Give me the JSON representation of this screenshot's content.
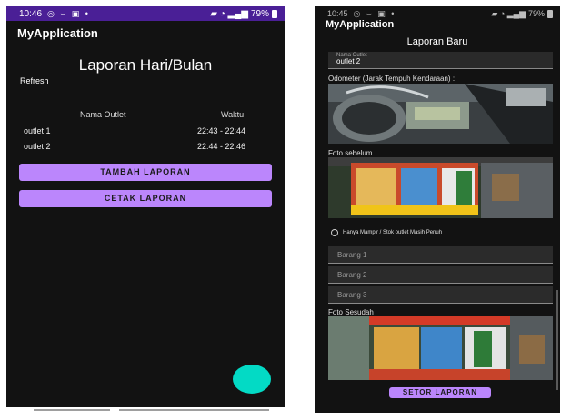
{
  "phone1": {
    "status_time": "10:46",
    "status_battery": "79%",
    "app_title": "MyApplication",
    "heading": "Laporan Hari/Bulan",
    "refresh": "Refresh",
    "columns": [
      "Nama Outlet",
      "Waktu"
    ],
    "rows": [
      {
        "outlet": "outlet 1",
        "time": "22:43 - 22:44"
      },
      {
        "outlet": "outlet 2",
        "time": "22:44 - 22:46"
      }
    ],
    "button_add": "TAMBAH LAPORAN",
    "button_print": "CETAK LAPORAN"
  },
  "phone2": {
    "status_time": "10:45",
    "status_battery": "79%",
    "app_title": "MyApplication",
    "heading": "Laporan Baru",
    "outlet_label": "Nama Outlet",
    "outlet_value": "outlet 2",
    "odometer_label": "Odometer (Jarak Tempuh Kendaraan) :",
    "before_label": "Foto sebelum",
    "radio_label": "Hanya Mampir / Stok outlet Masih Penuh",
    "items_placeholders": [
      "Barang 1",
      "Barang 2",
      "Barang 3"
    ],
    "after_label": "Foto Sesudah",
    "submit": "SETOR LAPORAN"
  },
  "colors": {
    "status_bar": "#4a1f96",
    "button": "#bb86fc",
    "fab": "#03dac5",
    "background": "#121212"
  },
  "icons": [
    "whatsapp-icon",
    "mute-icon",
    "wifi-icon",
    "signal-icon",
    "battery-icon",
    "add-icon"
  ]
}
